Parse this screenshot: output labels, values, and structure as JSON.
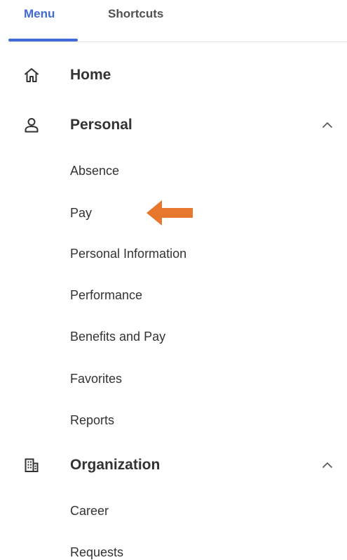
{
  "tabs": {
    "menu": "Menu",
    "shortcuts": "Shortcuts",
    "active_color": "#3f6ad8"
  },
  "sections": {
    "home": {
      "label": "Home",
      "icon": "home-icon"
    },
    "personal": {
      "label": "Personal",
      "icon": "person-icon",
      "expanded": true,
      "items": [
        "Absence",
        "Pay",
        "Personal Information",
        "Performance",
        "Benefits and Pay",
        "Favorites",
        "Reports"
      ]
    },
    "organization": {
      "label": "Organization",
      "icon": "building-icon",
      "expanded": true,
      "items": [
        "Career",
        "Requests"
      ]
    }
  },
  "annotation": {
    "icon": "left-arrow-icon",
    "color": "#e8772e",
    "points_to": "Pay"
  }
}
